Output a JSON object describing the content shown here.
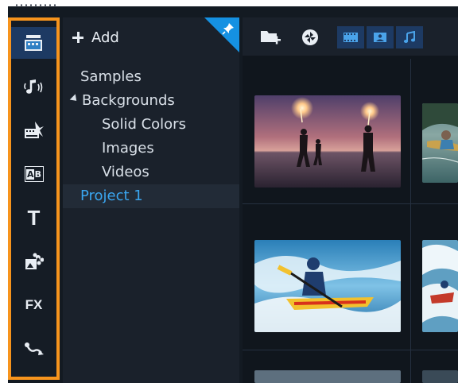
{
  "library": {
    "add_label": "Add",
    "tree": [
      {
        "label": "Samples",
        "level": 0,
        "selected": false
      },
      {
        "label": "Backgrounds",
        "level": 0,
        "expanded": true,
        "selected": false
      },
      {
        "label": "Solid Colors",
        "level": 1,
        "selected": false
      },
      {
        "label": "Images",
        "level": 1,
        "selected": false
      },
      {
        "label": "Videos",
        "level": 1,
        "selected": false
      },
      {
        "label": "Project 1",
        "level": 0,
        "selected": true
      }
    ]
  },
  "rail": {
    "items": [
      {
        "icon": "media-icon",
        "active": true
      },
      {
        "icon": "audio-icon",
        "active": false
      },
      {
        "icon": "instant-project-icon",
        "active": false
      },
      {
        "icon": "transition-icon",
        "label": "AB",
        "active": false
      },
      {
        "icon": "title-icon",
        "label": "T",
        "active": false
      },
      {
        "icon": "graphics-icon",
        "active": false
      },
      {
        "icon": "filter-icon",
        "label": "FX",
        "active": false
      },
      {
        "icon": "path-icon",
        "active": false
      }
    ]
  },
  "toolbar": {
    "buttons": [
      "import-folder-icon",
      "capture-icon",
      "video-filter-icon",
      "photo-filter-icon",
      "audio-filter-icon"
    ]
  },
  "thumbnails": [
    {
      "name": "beach-sparklers"
    },
    {
      "name": "kayak-lake"
    },
    {
      "name": "kayak-rapids"
    },
    {
      "name": "rapids-partial"
    }
  ],
  "colors": {
    "highlight": "#f7941d",
    "accent": "#3aa6f0",
    "active_tab": "#1d3a63"
  }
}
